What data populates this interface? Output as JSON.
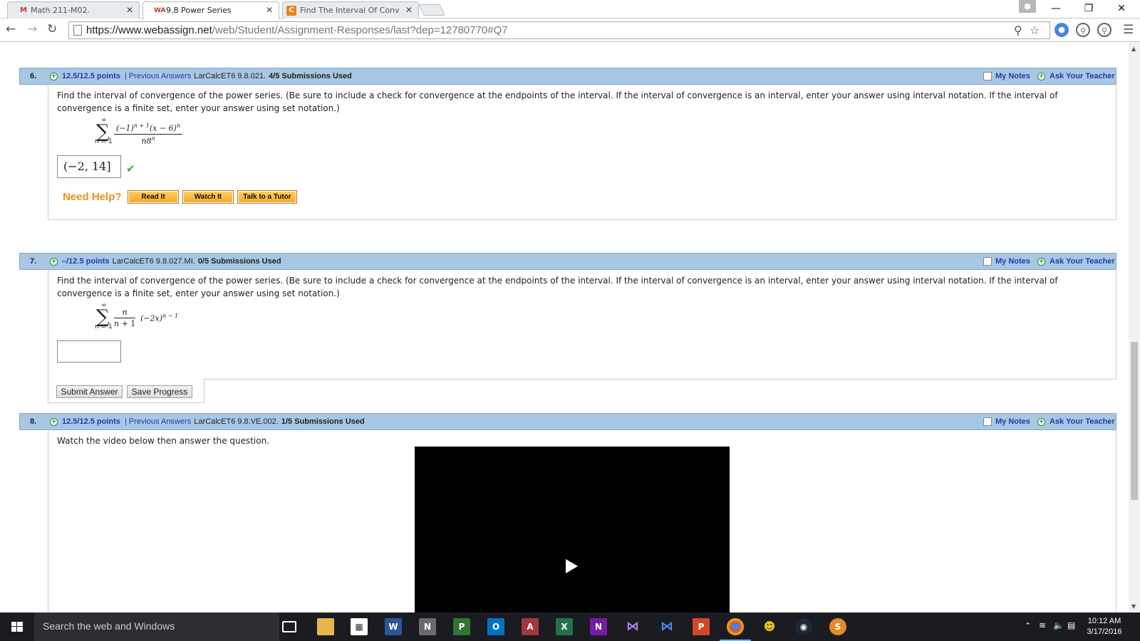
{
  "browser": {
    "tabs": [
      {
        "title": "Math 211-M02.",
        "favicon": "M",
        "active": false
      },
      {
        "title": "9.8 Power Series",
        "favicon": "WA",
        "active": true
      },
      {
        "title": "Find The Interval Of Conv",
        "favicon": "C",
        "active": false
      }
    ],
    "url_host": "https://www.webassign.net",
    "url_path": "/web/Student/Assignment-Responses/last?dep=12780770#Q7"
  },
  "questions": [
    {
      "number": "6.",
      "points": "12.5/12.5 points",
      "separator": "|",
      "previous_answers": "Previous Answers",
      "code": "LarCalcET6 9.8.021.",
      "submissions": "4/5 Submissions Used",
      "my_notes": "My Notes",
      "ask_teacher": "Ask Your Teacher",
      "prompt": "Find the interval of convergence of the power series. (Be sure to include a check for convergence at the endpoints of the interval. If the interval of convergence is an interval, enter your answer using interval notation. If the interval of convergence is a finite set, enter your answer using set notation.)",
      "sum_upper": "∞",
      "sum_lower": "n = 1",
      "answer": "(−2, 14]",
      "correct": true
    },
    {
      "number": "7.",
      "points": "–/12.5 points",
      "code": "LarCalcET6 9.8.027.MI.",
      "submissions": "0/5 Submissions Used",
      "my_notes": "My Notes",
      "ask_teacher": "Ask Your Teacher",
      "prompt": "Find the interval of convergence of the power series. (Be sure to include a check for convergence at the endpoints of the interval. If the interval of convergence is an interval, enter your answer using interval notation. If the interval of convergence is a finite set, enter your answer using set notation.)",
      "sum_upper": "∞",
      "sum_lower": "n = 1",
      "answer": ""
    },
    {
      "number": "8.",
      "points": "12.5/12.5 points",
      "separator": "|",
      "previous_answers": "Previous Answers",
      "code": "LarCalcET6 9.8.VE.002.",
      "submissions": "1/5 Submissions Used",
      "my_notes": "My Notes",
      "ask_teacher": "Ask Your Teacher",
      "prompt": "Watch the video below then answer the question."
    }
  ],
  "help": {
    "label": "Need Help?",
    "read_it": "Read It",
    "watch_it": "Watch It",
    "talk_tutor": "Talk to a Tutor"
  },
  "buttons": {
    "submit": "Submit Answer",
    "save": "Save Progress"
  },
  "taskbar": {
    "search_placeholder": "Search the web and Windows",
    "time": "10:12 AM",
    "date": "3/17/2016"
  },
  "colors": {
    "qbar_bg": "#a8c7e4",
    "link": "#1f3ea8",
    "help_orange": "#ef8d1a",
    "check_green": "#4aa04a"
  }
}
